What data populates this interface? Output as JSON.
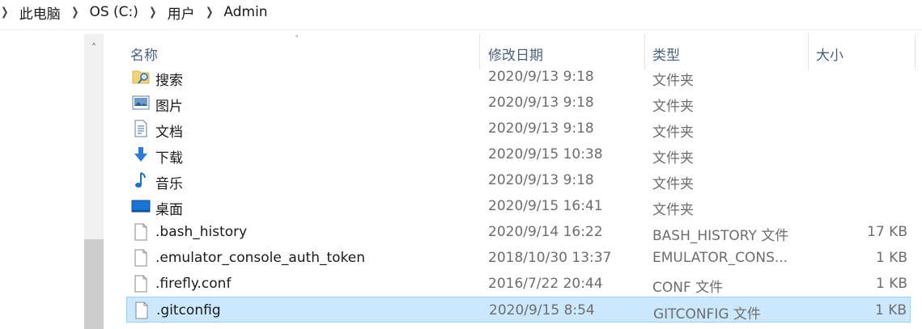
{
  "breadcrumb": {
    "items": [
      "此电脑",
      "OS (C:)",
      "用户",
      "Admin"
    ]
  },
  "columns": {
    "name": "名称",
    "date": "修改日期",
    "type": "类型",
    "size": "大小"
  },
  "files": [
    {
      "name": "搜索",
      "date": "2020/9/13 9:18",
      "type": "文件夹",
      "size": "",
      "icon": "search-folder-icon"
    },
    {
      "name": "图片",
      "date": "2020/9/13 9:18",
      "type": "文件夹",
      "size": "",
      "icon": "pictures-folder-icon"
    },
    {
      "name": "文档",
      "date": "2020/9/13 9:18",
      "type": "文件夹",
      "size": "",
      "icon": "documents-folder-icon"
    },
    {
      "name": "下载",
      "date": "2020/9/15 10:38",
      "type": "文件夹",
      "size": "",
      "icon": "downloads-folder-icon"
    },
    {
      "name": "音乐",
      "date": "2020/9/13 9:18",
      "type": "文件夹",
      "size": "",
      "icon": "music-folder-icon"
    },
    {
      "name": "桌面",
      "date": "2020/9/15 16:41",
      "type": "文件夹",
      "size": "",
      "icon": "desktop-folder-icon"
    },
    {
      "name": ".bash_history",
      "date": "2020/9/14 16:22",
      "type": "BASH_HISTORY 文件",
      "size": "17 KB",
      "icon": "file-icon"
    },
    {
      "name": ".emulator_console_auth_token",
      "date": "2018/10/30 13:37",
      "type": "EMULATOR_CONS...",
      "size": "1 KB",
      "icon": "file-icon"
    },
    {
      "name": ".firefly.conf",
      "date": "2016/7/22 20:44",
      "type": "CONF 文件",
      "size": "1 KB",
      "icon": "file-icon"
    },
    {
      "name": ".gitconfig",
      "date": "2020/9/15 8:54",
      "type": "GITCONFIG 文件",
      "size": "1 KB",
      "icon": "file-icon",
      "selected": true
    }
  ],
  "colors": {
    "selection_bg": "#cce8ff",
    "selection_border": "#99d1ff",
    "header_text": "#4c607a",
    "secondary_text": "#6d6d6d"
  }
}
